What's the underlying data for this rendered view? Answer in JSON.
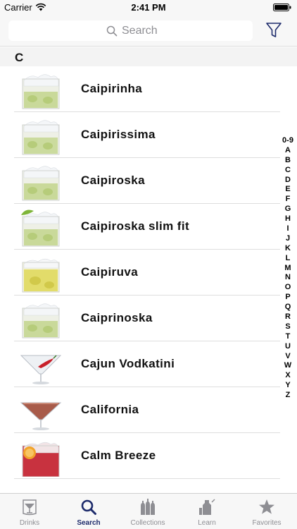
{
  "status_bar": {
    "carrier": "Carrier",
    "time": "2:41 PM"
  },
  "search": {
    "placeholder": "Search",
    "value": ""
  },
  "section": {
    "letter": "C"
  },
  "drinks": [
    {
      "name": "Caipirinha",
      "glass": "rocks-green"
    },
    {
      "name": "Caipirissima",
      "glass": "rocks-green"
    },
    {
      "name": "Caipiroska",
      "glass": "rocks-green"
    },
    {
      "name": "Caipiroska slim fit",
      "glass": "rocks-green-lime"
    },
    {
      "name": "Caipiruva",
      "glass": "rocks-yellow"
    },
    {
      "name": "Caiprinoska",
      "glass": "rocks-green"
    },
    {
      "name": "Cajun Vodkatini",
      "glass": "martini-clear-pepper"
    },
    {
      "name": "California",
      "glass": "martini-red"
    },
    {
      "name": "Calm Breeze",
      "glass": "rocks-red-orange"
    }
  ],
  "alphabet_index": [
    "0-9",
    "A",
    "B",
    "C",
    "D",
    "E",
    "F",
    "G",
    "H",
    "I",
    "J",
    "K",
    "L",
    "M",
    "N",
    "O",
    "P",
    "Q",
    "R",
    "S",
    "T",
    "U",
    "V",
    "W",
    "X",
    "Y",
    "Z"
  ],
  "tabs": [
    {
      "label": "Drinks",
      "icon": "drinks-icon",
      "active": false
    },
    {
      "label": "Search",
      "icon": "search-icon",
      "active": true
    },
    {
      "label": "Collections",
      "icon": "collections-icon",
      "active": false
    },
    {
      "label": "Learn",
      "icon": "learn-icon",
      "active": false
    },
    {
      "label": "Favorites",
      "icon": "favorites-icon",
      "active": false
    }
  ],
  "colors": {
    "accent": "#1d2b6b",
    "inactive": "#8e8e93"
  }
}
